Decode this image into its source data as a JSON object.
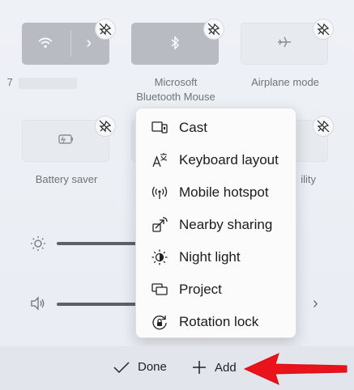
{
  "tiles": [
    {
      "id": "wifi",
      "label": "7",
      "label_line2": "",
      "state": "active",
      "icon": "wifi-icon"
    },
    {
      "id": "bluetooth",
      "label": "Microsoft",
      "label_line2": "Bluetooth Mouse",
      "state": "active",
      "icon": "bluetooth-icon"
    },
    {
      "id": "airplane",
      "label": "Airplane mode",
      "label_line2": "",
      "state": "inactive",
      "icon": "airplane-icon"
    },
    {
      "id": "battery-saver",
      "label": "Battery saver",
      "label_line2": "",
      "state": "inactive",
      "icon": "battery-saver-icon"
    },
    {
      "id": "accessibility",
      "label": "ility",
      "label_line2": "",
      "state": "inactive",
      "icon": ""
    }
  ],
  "sliders": {
    "brightness": {
      "icon": "brightness-icon"
    },
    "volume": {
      "icon": "volume-icon"
    }
  },
  "menu": {
    "items": [
      {
        "label": "Cast",
        "icon": "cast-icon"
      },
      {
        "label": "Keyboard layout",
        "icon": "keyboard-layout-icon"
      },
      {
        "label": "Mobile hotspot",
        "icon": "mobile-hotspot-icon"
      },
      {
        "label": "Nearby sharing",
        "icon": "nearby-sharing-icon"
      },
      {
        "label": "Night light",
        "icon": "night-light-icon"
      },
      {
        "label": "Project",
        "icon": "project-icon"
      },
      {
        "label": "Rotation lock",
        "icon": "rotation-lock-icon"
      }
    ]
  },
  "bottom": {
    "done_label": "Done",
    "add_label": "Add"
  },
  "colors": {
    "arrow": "#e8131b"
  }
}
